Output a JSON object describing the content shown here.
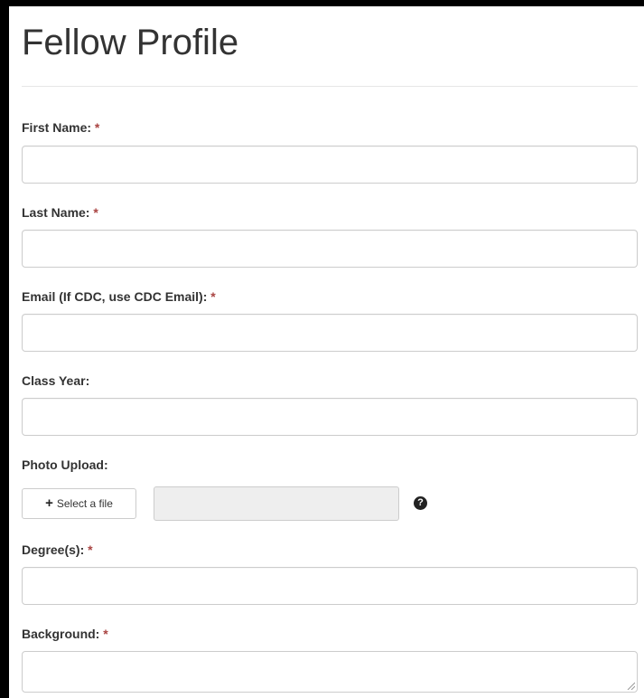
{
  "page": {
    "title": "Fellow Profile"
  },
  "fields": {
    "first_name": {
      "label": "First Name:",
      "required_mark": "*",
      "value": ""
    },
    "last_name": {
      "label": "Last Name:",
      "required_mark": "*",
      "value": ""
    },
    "email": {
      "label": "Email (If CDC, use CDC Email):",
      "required_mark": "*",
      "value": ""
    },
    "class_year": {
      "label": "Class Year:",
      "value": ""
    },
    "photo_upload": {
      "label": "Photo Upload:",
      "button_label": "Select a file",
      "button_icon": "plus-icon",
      "file_name": "",
      "help_icon": "question-circle-icon",
      "help_glyph": "?"
    },
    "degrees": {
      "label": "Degree(s):",
      "required_mark": "*",
      "value": ""
    },
    "background": {
      "label": "Background:",
      "required_mark": "*",
      "value": ""
    }
  },
  "colors": {
    "required_mark": "#a94442",
    "label_text": "#333333",
    "input_border": "#cccccc",
    "disabled_field": "#eeeeee"
  }
}
